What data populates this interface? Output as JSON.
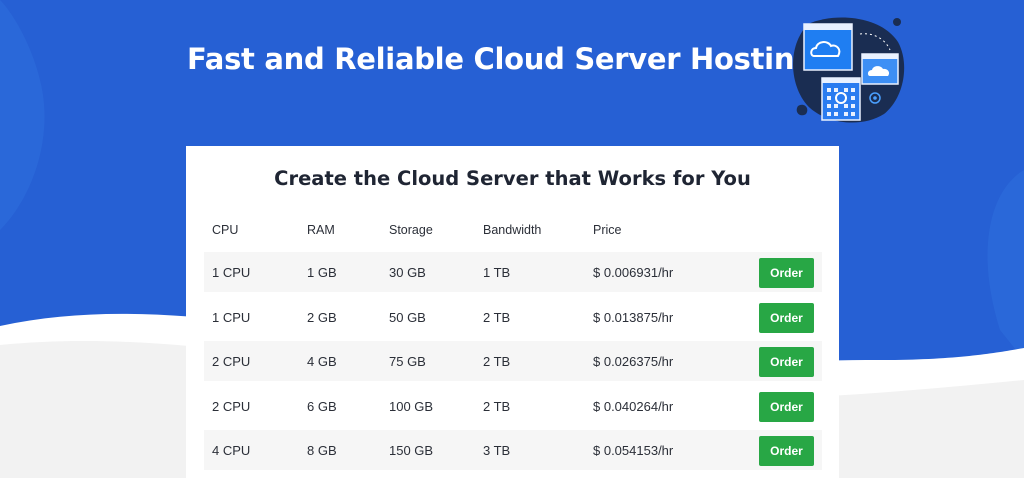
{
  "hero": {
    "headline": "Fast and Reliable Cloud Server Hosting",
    "background_color": "#2660d4",
    "illustration": "cloud-server-illustration"
  },
  "pricing": {
    "title": "Create the Cloud Server that Works for You",
    "columns": [
      "CPU",
      "RAM",
      "Storage",
      "Bandwidth",
      "Price"
    ],
    "rows": [
      {
        "cpu": "1 CPU",
        "ram": "1 GB",
        "storage": "30 GB",
        "bandwidth": "1 TB",
        "price": "$ 0.006931/hr",
        "action": "Order"
      },
      {
        "cpu": "1 CPU",
        "ram": "2 GB",
        "storage": "50 GB",
        "bandwidth": "2 TB",
        "price": "$ 0.013875/hr",
        "action": "Order"
      },
      {
        "cpu": "2 CPU",
        "ram": "4 GB",
        "storage": "75 GB",
        "bandwidth": "2 TB",
        "price": "$ 0.026375/hr",
        "action": "Order"
      },
      {
        "cpu": "2 CPU",
        "ram": "6 GB",
        "storage": "100 GB",
        "bandwidth": "2 TB",
        "price": "$ 0.040264/hr",
        "action": "Order"
      },
      {
        "cpu": "4 CPU",
        "ram": "8 GB",
        "storage": "150 GB",
        "bandwidth": "3 TB",
        "price": "$ 0.054153/hr",
        "action": "Order"
      }
    ],
    "order_button_color": "#28a745"
  }
}
